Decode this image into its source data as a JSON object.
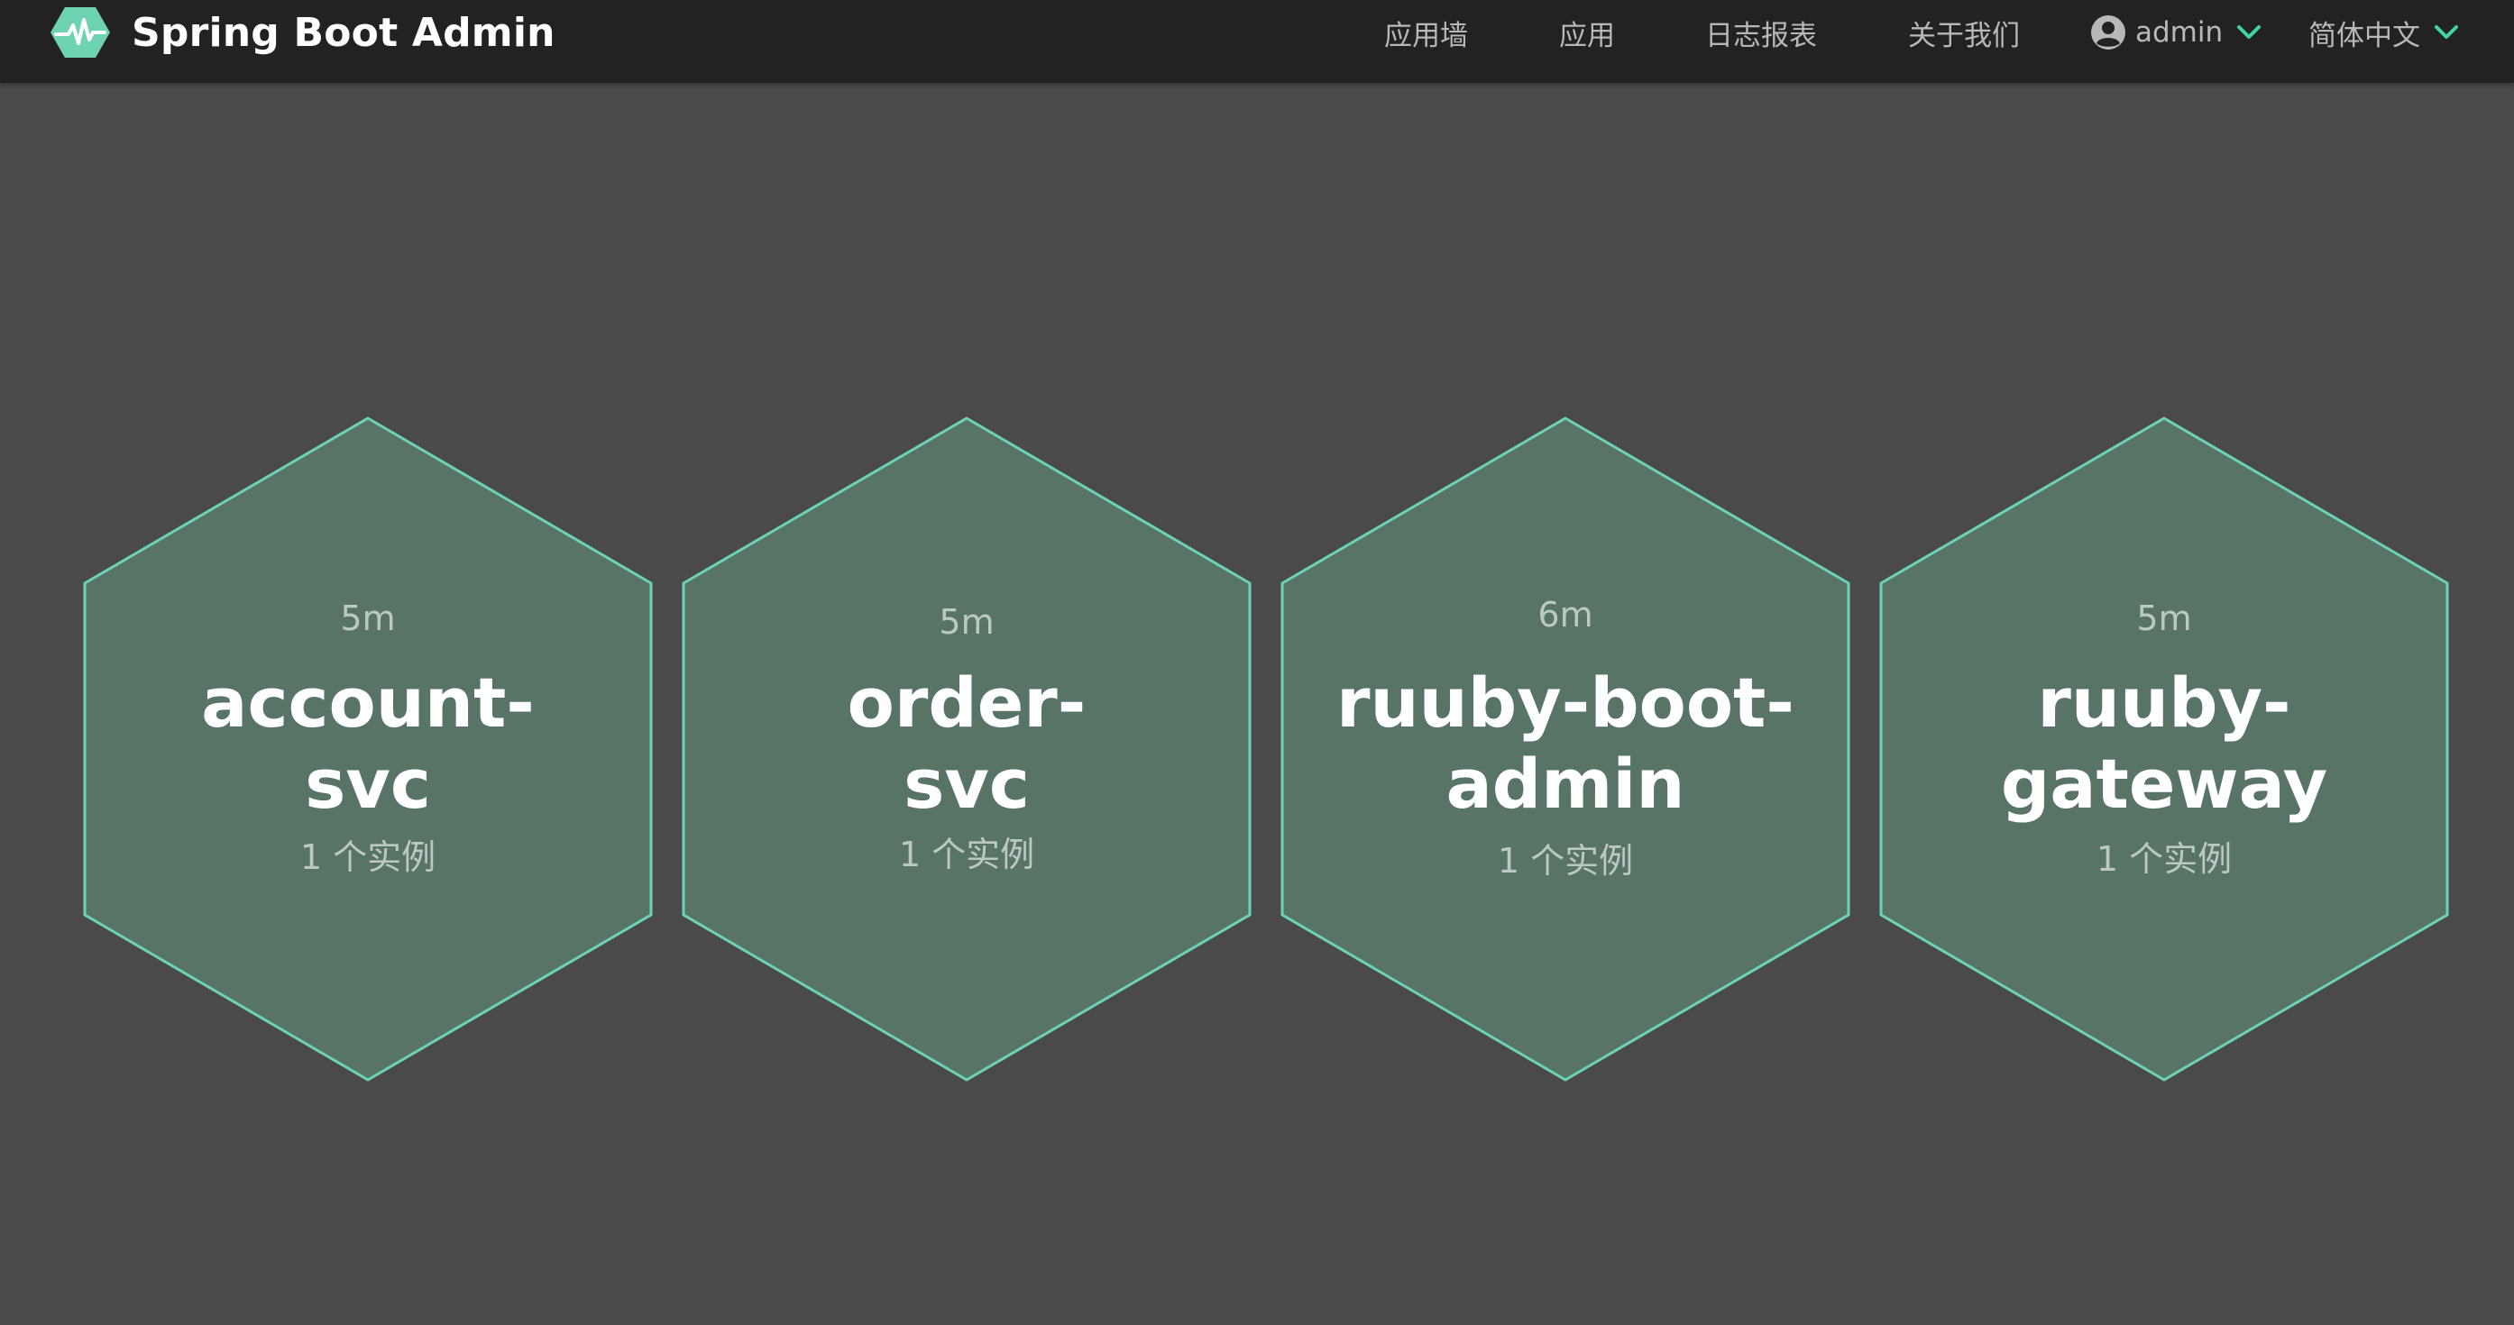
{
  "navbar": {
    "brand_title": "Spring Boot Admin",
    "brand_icon": "heartbeat-hexagon-icon",
    "items": [
      {
        "label": "应用墙"
      },
      {
        "label": "应用"
      },
      {
        "label": "日志报表"
      },
      {
        "label": "关于我们"
      }
    ],
    "user": {
      "label": "admin",
      "icon": "user-circle-icon"
    },
    "language": {
      "label": "简体中文"
    }
  },
  "applications": [
    {
      "time": "5m",
      "name_line1": "account-",
      "name_line2": "svc",
      "instances": "1 个实例"
    },
    {
      "time": "5m",
      "name_line1": "order-",
      "name_line2": "svc",
      "instances": "1 个实例"
    },
    {
      "time": "6m",
      "name_line1": "ruuby-boot-",
      "name_line2": "admin",
      "instances": "1 个实例"
    },
    {
      "time": "5m",
      "name_line1": "ruuby-",
      "name_line2": "gateway",
      "instances": "1 个实例"
    }
  ],
  "colors": {
    "navbar_bg": "#222222",
    "page_bg": "#4a4a4a",
    "hex_fill": "#577466",
    "hex_stroke": "#6ed3b2",
    "accent": "#42d3a5"
  }
}
